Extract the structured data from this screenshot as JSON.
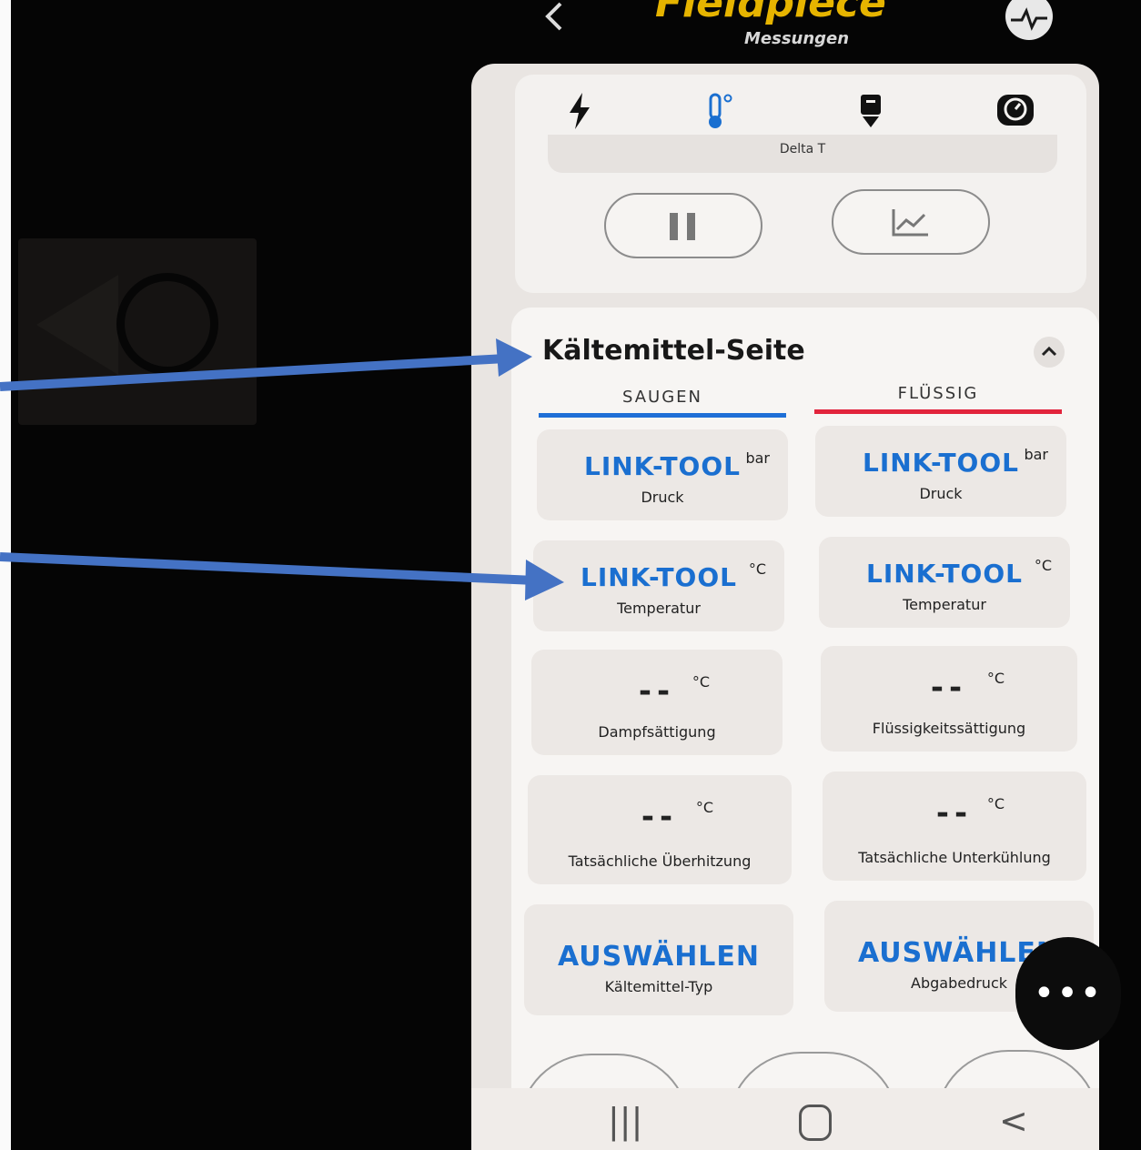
{
  "header": {
    "back_icon": "chevron-left-icon",
    "title": "Fieldpiece",
    "subtitle": "Messungen",
    "status_icon": "pulse-icon"
  },
  "tabs": [
    {
      "icon": "lightning-icon"
    },
    {
      "icon": "thermometer-icon"
    },
    {
      "icon": "pump-icon"
    },
    {
      "icon": "gauge-icon"
    }
  ],
  "delta": {
    "label": "Delta T"
  },
  "controls": {
    "pause_icon": "pause-icon",
    "chart_icon": "chart-icon"
  },
  "section": {
    "title": "Kältemittel-Seite",
    "suction_header": "SAUGEN",
    "liquid_header": "FLÜSSIG",
    "colors": {
      "suction": "#1f6fd6",
      "liquid": "#e2243c",
      "accent": "#1a6fd0"
    }
  },
  "tiles": {
    "suction_pressure": {
      "value": "LINK-TOOL",
      "unit": "bar",
      "label": "Druck"
    },
    "liquid_pressure": {
      "value": "LINK-TOOL",
      "unit": "bar",
      "label": "Druck"
    },
    "suction_temp": {
      "value": "LINK-TOOL",
      "unit": "°C",
      "label": "Temperatur"
    },
    "liquid_temp": {
      "value": "LINK-TOOL",
      "unit": "°C",
      "label": "Temperatur"
    },
    "vapor_saturation": {
      "value": "--",
      "unit": "°C",
      "label": "Dampfsättigung"
    },
    "liquid_saturation": {
      "value": "--",
      "unit": "°C",
      "label": "Flüssigkeitssättigung"
    },
    "superheat": {
      "value": "--",
      "unit": "°C",
      "label": "Tatsächliche Überhitzung"
    },
    "subcooling": {
      "value": "--",
      "unit": "°C",
      "label": "Tatsächliche Unterkühlung"
    },
    "refrigerant_type": {
      "value": "AUSWÄHLEN",
      "label": "Kältemittel-Typ"
    },
    "discharge": {
      "value": "AUSWÄHLEN",
      "label": "Abgabedruck"
    }
  },
  "fab": {
    "icon": "more-icon",
    "label": "•••"
  },
  "nav": {
    "recent": "|||",
    "back": "<"
  }
}
